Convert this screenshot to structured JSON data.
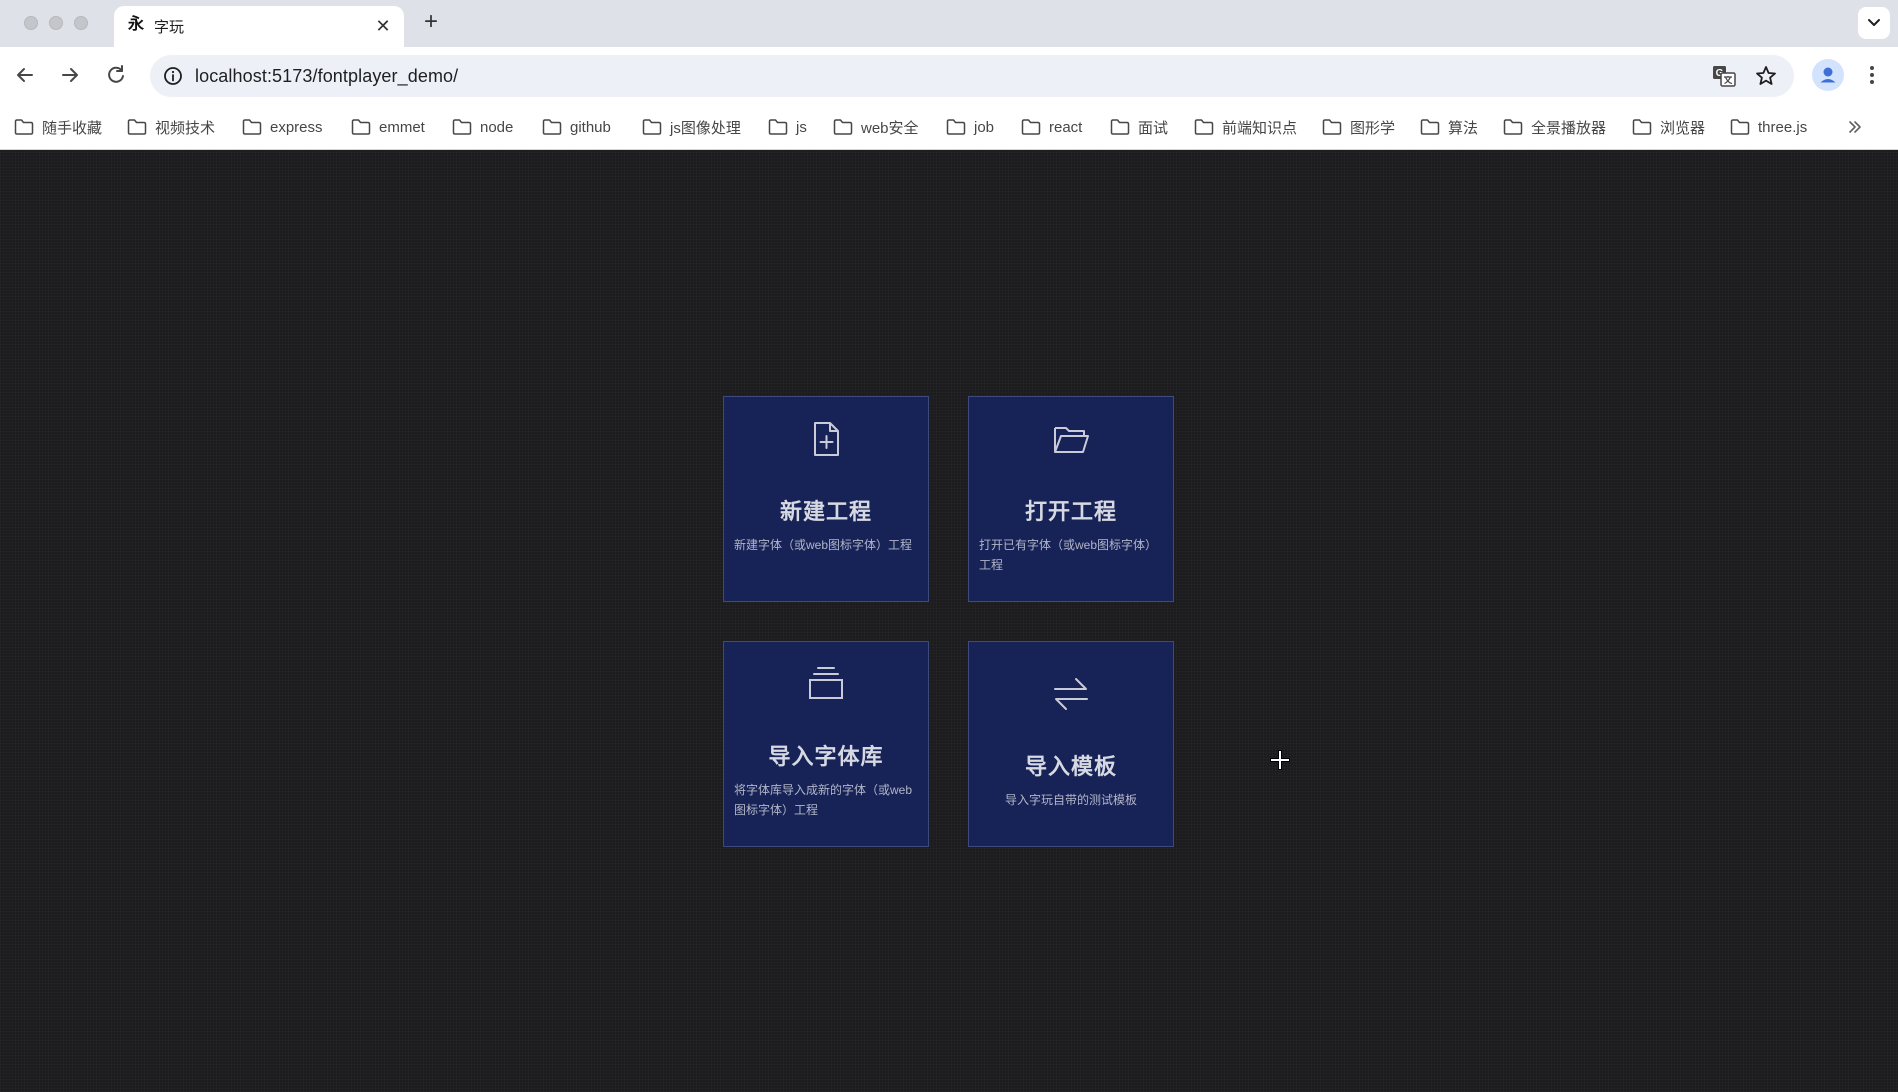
{
  "browser": {
    "tab": {
      "favicon_glyph": "永",
      "title": "字玩"
    },
    "address_bar": {
      "url": "localhost:5173/fontplayer_demo/"
    },
    "bookmarks": [
      {
        "label": "随手收藏"
      },
      {
        "label": "视频技术"
      },
      {
        "label": "express"
      },
      {
        "label": "emmet"
      },
      {
        "label": "node"
      },
      {
        "label": "github"
      },
      {
        "label": "js图像处理"
      },
      {
        "label": "js"
      },
      {
        "label": "web安全"
      },
      {
        "label": "job"
      },
      {
        "label": "react"
      },
      {
        "label": "面试"
      },
      {
        "label": "前端知识点"
      },
      {
        "label": "图形学"
      },
      {
        "label": "算法"
      },
      {
        "label": "全景播放器"
      },
      {
        "label": "浏览器"
      },
      {
        "label": "three.js"
      }
    ]
  },
  "main": {
    "cards": [
      {
        "icon": "file-plus-icon",
        "title": "新建工程",
        "desc": "新建字体（或web图标字体）工程"
      },
      {
        "icon": "folder-open-icon",
        "title": "打开工程",
        "desc": "打开已有字体（或web图标字体）工程"
      },
      {
        "icon": "layers-icon",
        "title": "导入字体库",
        "desc": "将字体库导入成新的字体（或web图标字体）工程"
      },
      {
        "icon": "switch-arrows-icon",
        "title": "导入模板",
        "desc": "导入字玩自带的测试模板"
      }
    ]
  },
  "colors": {
    "page_background": "#1c1c1e",
    "card_background": "#172357",
    "card_border": "#3d4a7e",
    "card_title": "#d7d9e2",
    "card_text": "#b2b6c8"
  }
}
